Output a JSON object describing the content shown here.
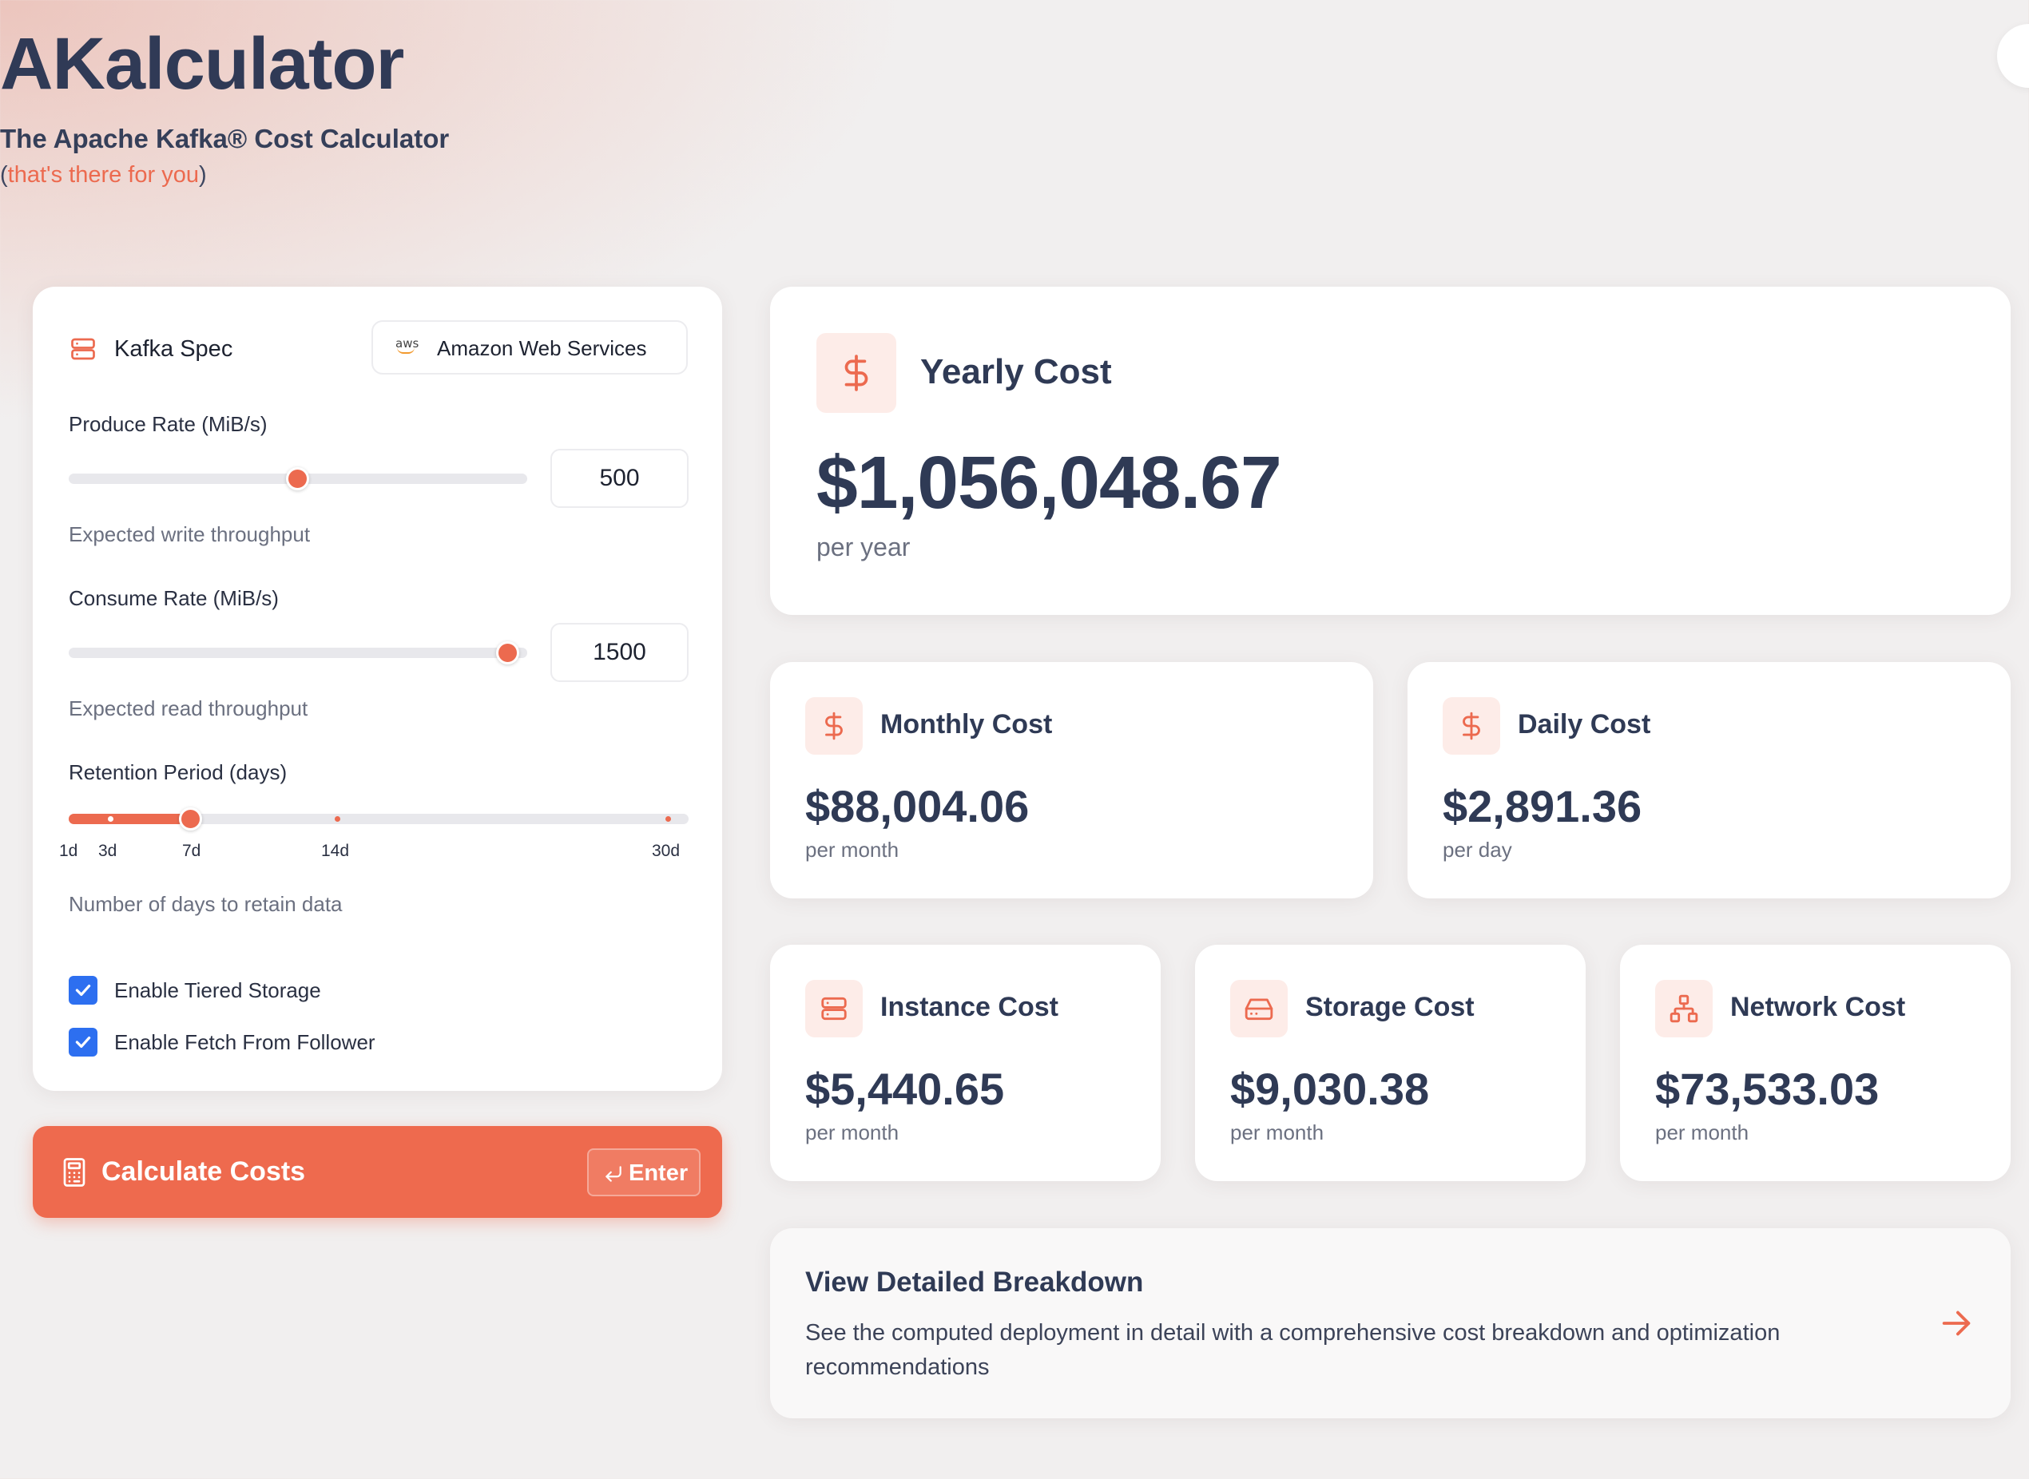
{
  "header": {
    "title": "AKalculator",
    "subtitle": "The Apache Kafka® Cost Calculator",
    "tagline_open": "(",
    "tagline_accent": "that's there for you",
    "tagline_close": ")"
  },
  "spec": {
    "title": "Kafka Spec",
    "provider": "Amazon Web Services",
    "provider_logo_text": "aws",
    "produce": {
      "label": "Produce Rate (MiB/s)",
      "value": "500",
      "help": "Expected write throughput",
      "slider_fraction": 0.5
    },
    "consume": {
      "label": "Consume Rate (MiB/s)",
      "value": "1500",
      "help": "Expected read throughput",
      "slider_fraction": 1.0
    },
    "retention": {
      "label": "Retention Period (days)",
      "help": "Number of days to retain data",
      "selected": "7d",
      "ticks": [
        "1d",
        "3d",
        "7d",
        "14d",
        "30d"
      ]
    },
    "checkboxes": [
      {
        "label": "Enable Tiered Storage",
        "checked": true
      },
      {
        "label": "Enable Fetch From Follower",
        "checked": true
      }
    ]
  },
  "calculate": {
    "label": "Calculate Costs",
    "shortcut": "Enter"
  },
  "costs": {
    "yearly": {
      "title": "Yearly Cost",
      "amount": "$1,056,048.67",
      "period": "per year"
    },
    "monthly": {
      "title": "Monthly Cost",
      "amount": "$88,004.06",
      "period": "per month"
    },
    "daily": {
      "title": "Daily Cost",
      "amount": "$2,891.36",
      "period": "per day"
    },
    "instance": {
      "title": "Instance Cost",
      "amount": "$5,440.65",
      "period": "per month"
    },
    "storage": {
      "title": "Storage Cost",
      "amount": "$9,030.38",
      "period": "per month"
    },
    "network": {
      "title": "Network Cost",
      "amount": "$73,533.03",
      "period": "per month"
    }
  },
  "breakdown": {
    "title": "View Detailed Breakdown",
    "description": "See the computed deployment in detail with a comprehensive cost breakdown and optimization recommendations"
  },
  "colors": {
    "accent": "#ec6a4f",
    "text": "#2f3a55",
    "checkbox": "#2d6ff0"
  }
}
